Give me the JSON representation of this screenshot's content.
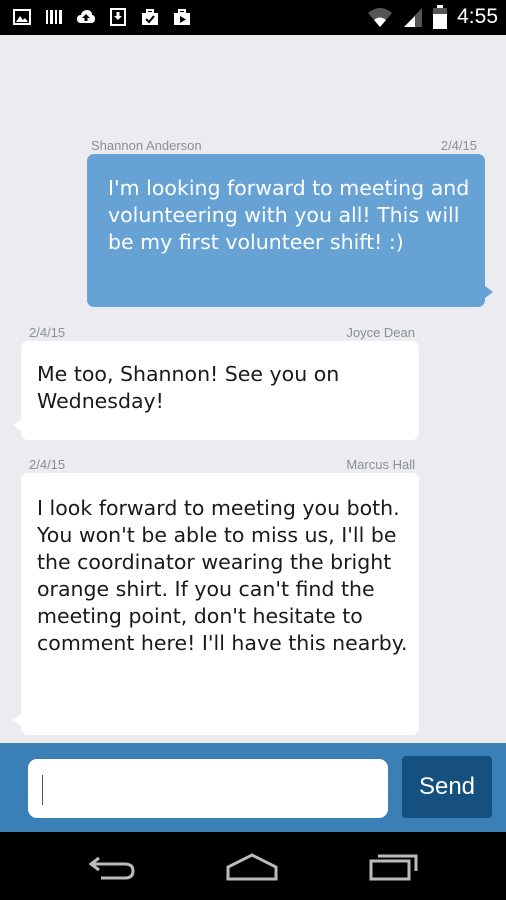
{
  "status_bar": {
    "time": "4:55",
    "left_icons": [
      "image-icon",
      "barcode-icon",
      "cloud-upload-icon",
      "download-icon",
      "briefcase-check-icon",
      "briefcase-play-icon"
    ],
    "right_icons": [
      "wifi-icon",
      "signal-icon",
      "battery-icon"
    ]
  },
  "messages": [
    {
      "sender": "Shannon Anderson",
      "date": "2/4/15",
      "text": "I'm looking forward to meeting and volunteering with you all! This will be my first volunteer shift! :)",
      "direction": "outgoing"
    },
    {
      "sender": "Joyce Dean",
      "date": "2/4/15",
      "text": "Me too, Shannon! See you on Wednesday!",
      "direction": "incoming"
    },
    {
      "sender": "Marcus Hall",
      "date": "2/4/15",
      "text": "I look forward to meeting you both. You won't be able to miss us, I'll be the coordinator wearing the bright orange shirt. If you can't find the meeting point, don't hesitate to comment here! I'll have this nearby.",
      "direction": "incoming"
    }
  ],
  "composer": {
    "input_value": "",
    "send_label": "Send"
  },
  "nav_bar": {
    "buttons": [
      "back-icon",
      "home-icon",
      "recents-icon"
    ]
  },
  "colors": {
    "outgoing_bubble": "#66a2d4",
    "incoming_bubble": "#ffffff",
    "chat_background": "#ebebf0",
    "composer_bar": "#3b7fb7",
    "send_button": "#15507e"
  }
}
